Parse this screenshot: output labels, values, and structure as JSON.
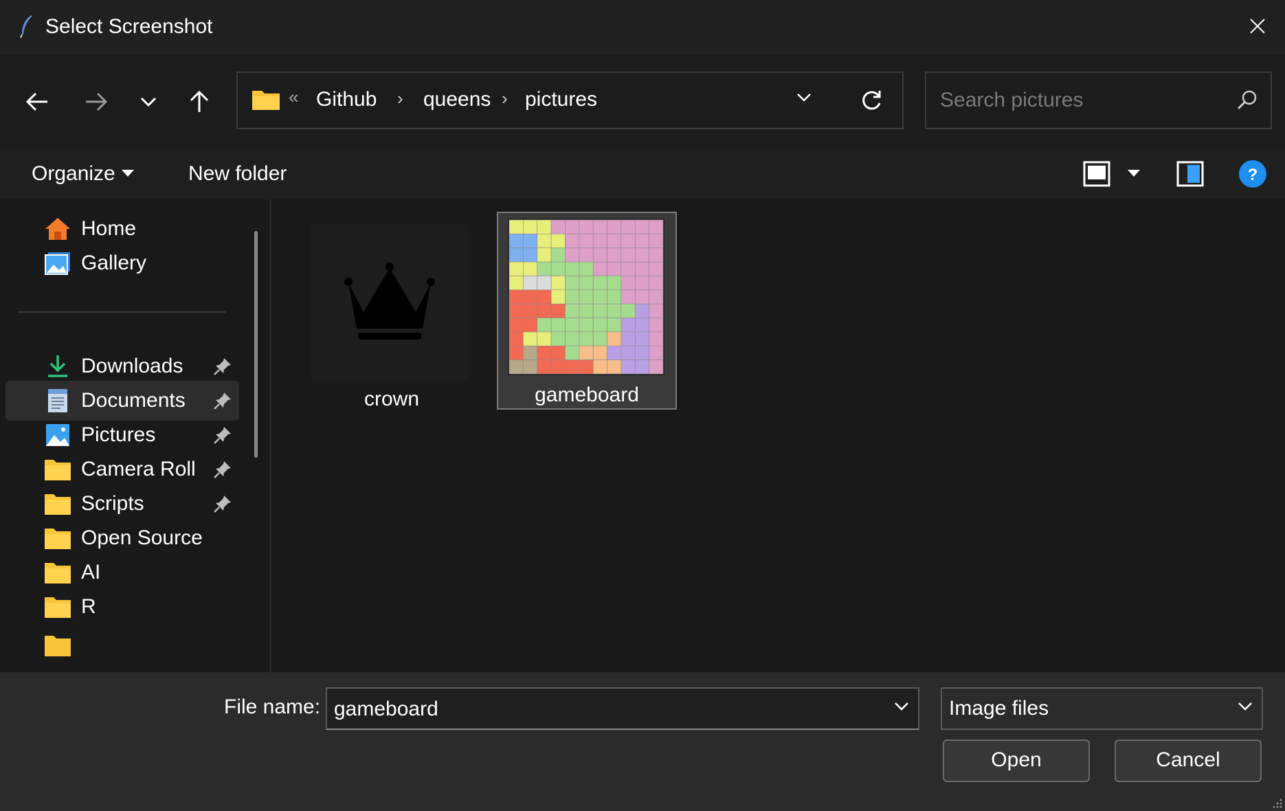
{
  "window": {
    "title": "Select Screenshot"
  },
  "address_bar": {
    "overflow_marker": "«",
    "breadcrumbs": [
      "Github",
      "queens",
      "pictures"
    ],
    "separator": "›"
  },
  "search": {
    "placeholder": "Search pictures"
  },
  "toolbar": {
    "organize_label": "Organize",
    "new_folder_label": "New folder",
    "help_color": "#1f8ef1"
  },
  "sidebar": {
    "quick_items": [
      {
        "label": "Home",
        "icon": "home-icon"
      },
      {
        "label": "Gallery",
        "icon": "gallery-icon"
      }
    ],
    "pinned_items": [
      {
        "label": "Downloads",
        "icon": "download-icon",
        "pinned": true
      },
      {
        "label": "Documents",
        "icon": "documents-icon",
        "pinned": true,
        "selected": true
      },
      {
        "label": "Pictures",
        "icon": "pictures-icon",
        "pinned": true
      },
      {
        "label": "Camera Roll",
        "icon": "folder-icon",
        "pinned": true
      },
      {
        "label": "Scripts",
        "icon": "folder-icon",
        "pinned": true
      },
      {
        "label": "Open Source",
        "icon": "folder-icon",
        "pinned": false
      },
      {
        "label": "AI",
        "icon": "folder-icon",
        "pinned": false
      },
      {
        "label": "R",
        "icon": "folder-icon",
        "pinned": false
      }
    ]
  },
  "files": [
    {
      "name": "crown",
      "thumbnail": "crown-icon",
      "selected": false
    },
    {
      "name": "gameboard",
      "thumbnail": "gameboard-thumbnail",
      "selected": true
    }
  ],
  "bottom": {
    "file_name_label": "File name:",
    "file_name_value": "gameboard",
    "file_type_value": "Image files",
    "open_label": "Open",
    "cancel_label": "Cancel"
  },
  "colors": {
    "folder_yellow": "#f8c53a",
    "accent_blue": "#1f8ef1"
  }
}
